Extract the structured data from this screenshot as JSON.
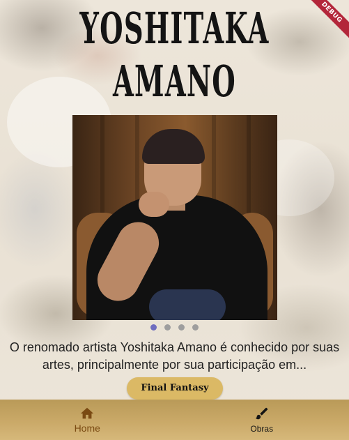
{
  "header": {
    "title_line1": "YOSHITAKA",
    "title_line2": "AMANO"
  },
  "carousel": {
    "image_icon": "portrait-photo",
    "slides_count": 4,
    "active_index": 0
  },
  "description": {
    "text": "O renomado artista Yoshitaka Amano é conhecido por suas artes, principalmente por sua participação em..."
  },
  "cta": {
    "label": "Final Fantasy",
    "color": "#dbb965"
  },
  "bottom_nav": {
    "items": [
      {
        "label": "Home",
        "icon": "home-icon",
        "active": true
      },
      {
        "label": "Obras",
        "icon": "brush-icon",
        "active": false
      }
    ],
    "active_color": "#7a4a12"
  },
  "debug_banner": {
    "label": "DEBUG",
    "color": "#b3263a"
  }
}
